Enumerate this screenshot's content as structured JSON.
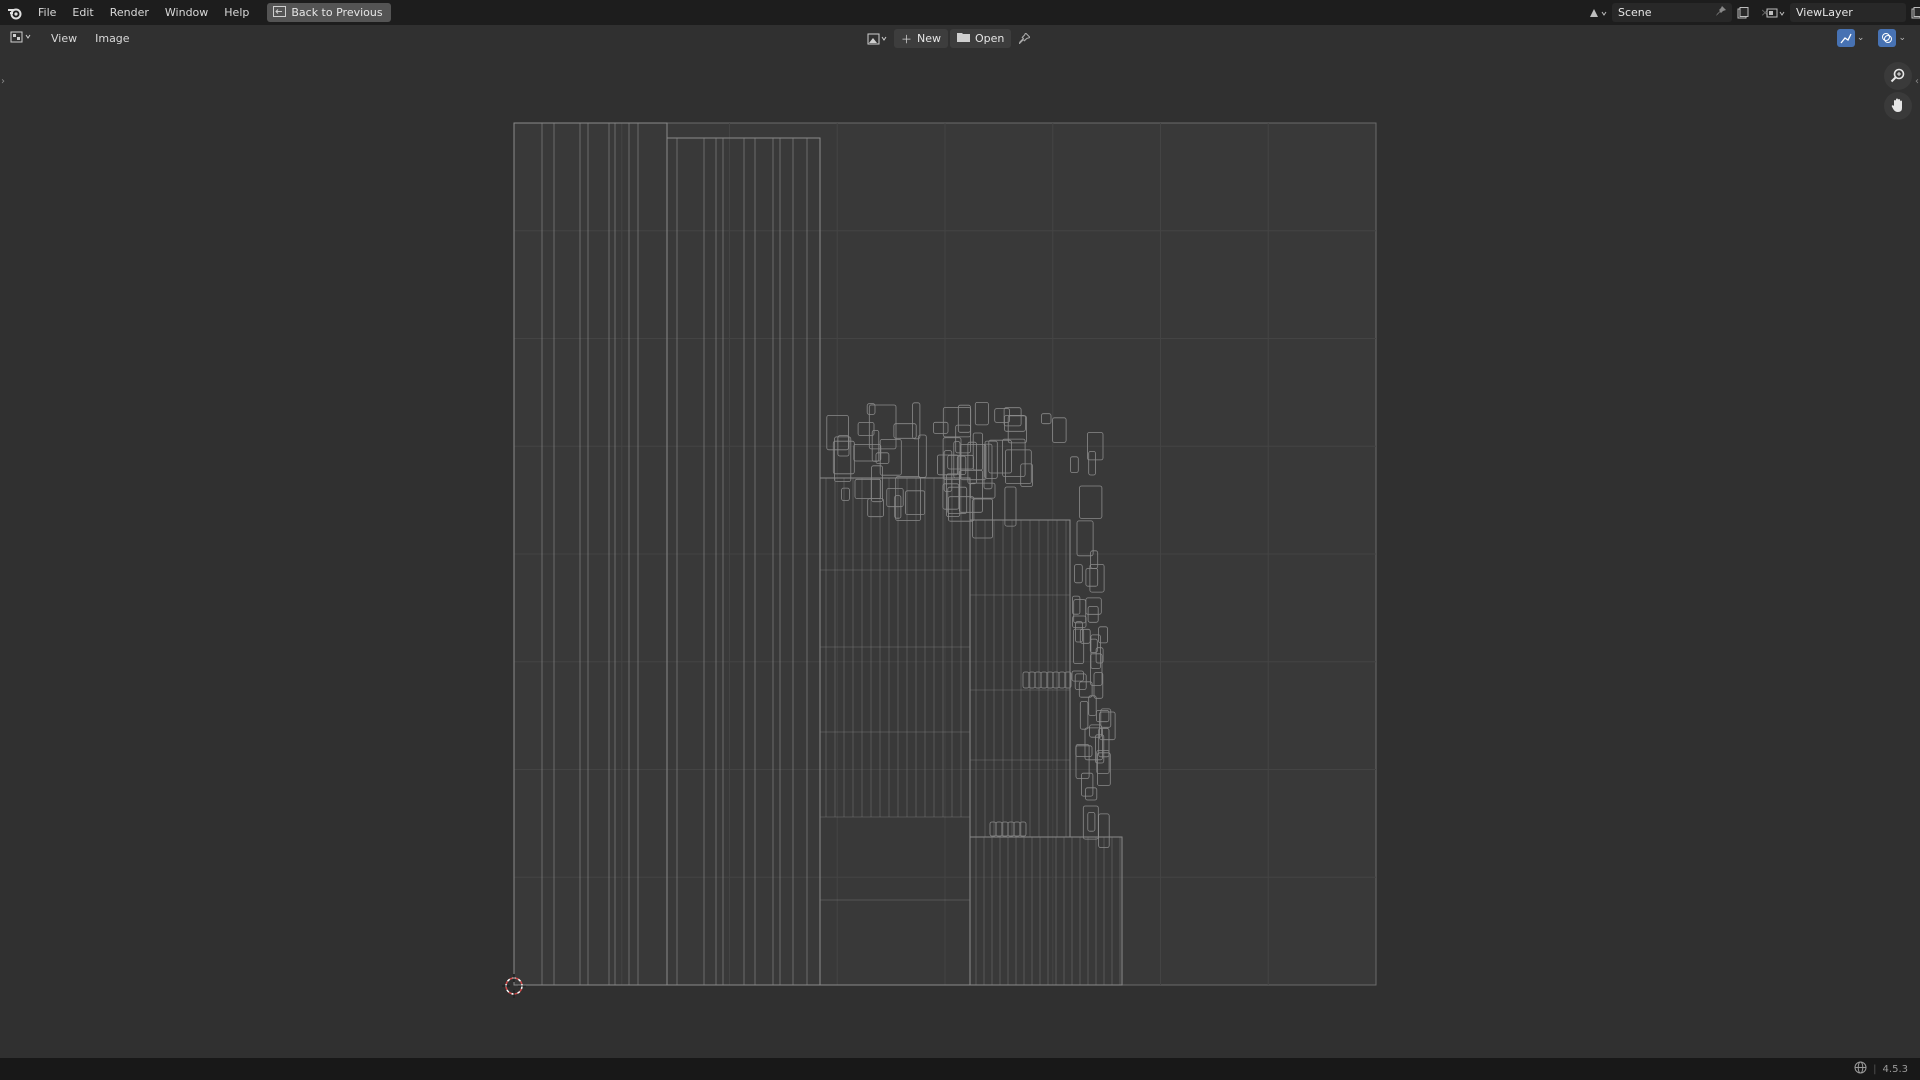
{
  "app": {
    "menus": [
      "File",
      "Edit",
      "Render",
      "Window",
      "Help"
    ],
    "back_label": "Back to Previous"
  },
  "scene": {
    "name": "Scene"
  },
  "view_layer": {
    "name": "ViewLayer"
  },
  "editor": {
    "menus": [
      "View",
      "Image"
    ],
    "new_label": "New",
    "open_label": "Open"
  },
  "status": {
    "version": "4.5.3"
  },
  "colors": {
    "topbar": "#1d1d1d",
    "editor_bg": "#303030",
    "uv_tile": "#393939",
    "uv_wire": "#8a8a8a",
    "accent_blue": "#4772b3",
    "cursor": "#d44a4a"
  },
  "icons": {
    "logo": "blender-logo-icon",
    "back": "back-to-previous-icon",
    "scene": "scene-icon",
    "view_layer": "view-layer-icon",
    "pin": "pin-icon",
    "editor_type": "uv-editor-icon",
    "zoom": "zoom-icon",
    "pan": "hand-icon",
    "globe": "globe-icon"
  }
}
